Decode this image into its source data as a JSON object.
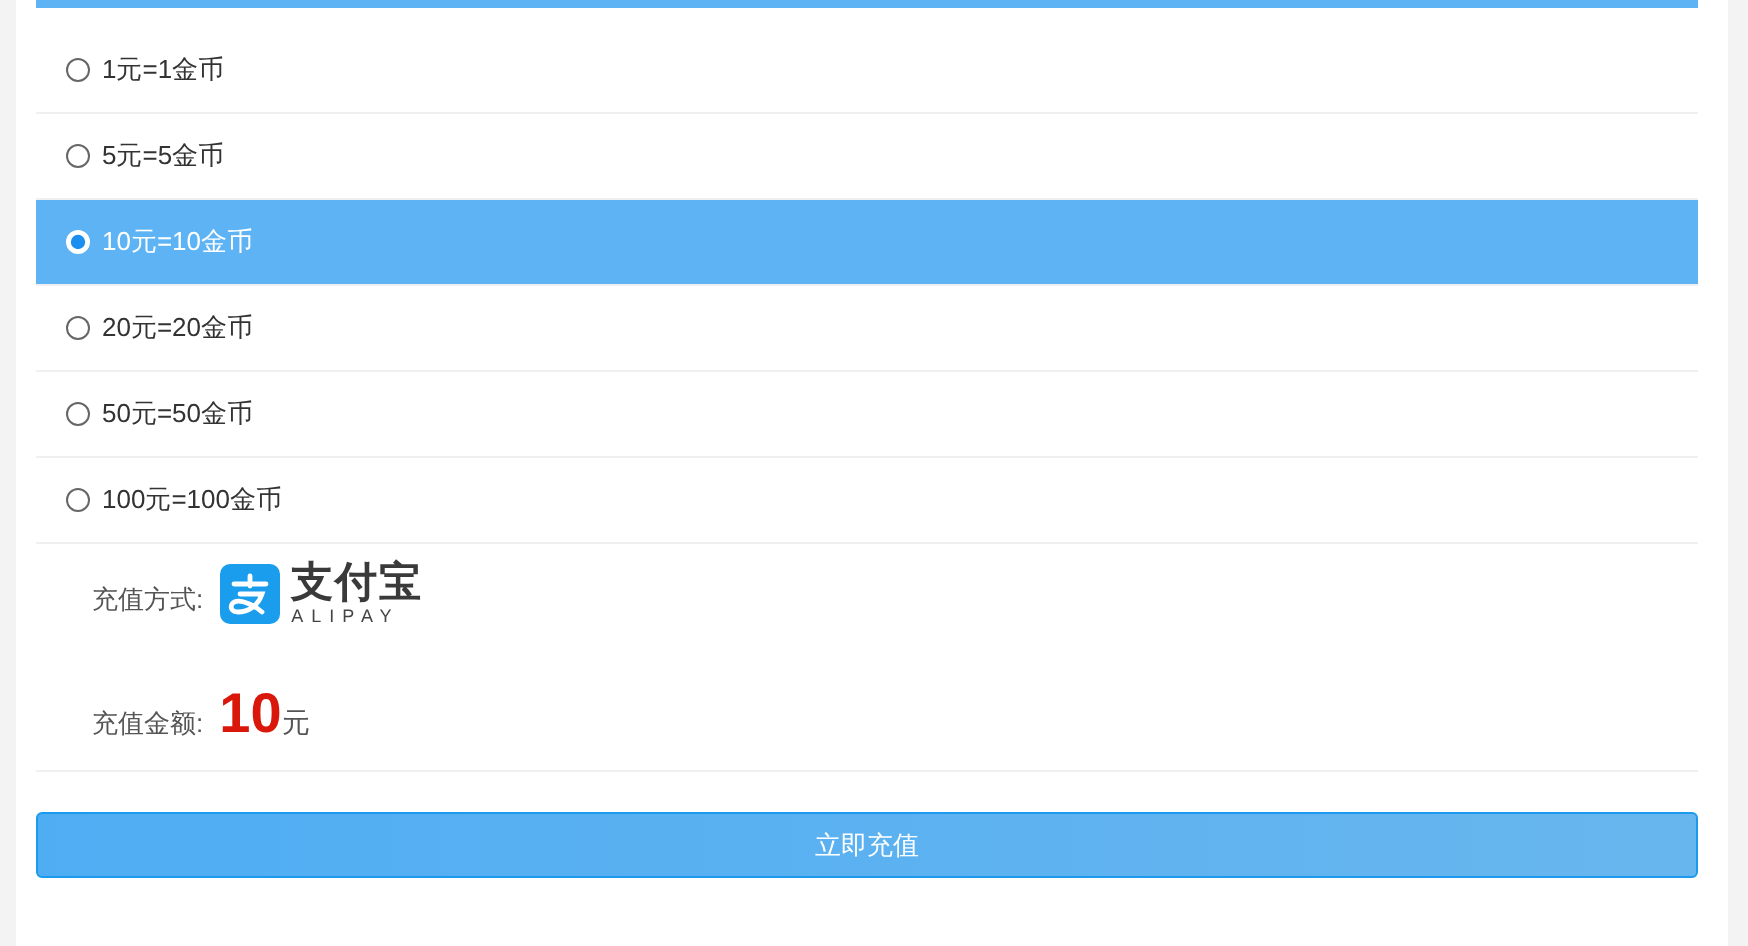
{
  "options": [
    {
      "label": "1元=1金币",
      "selected": false
    },
    {
      "label": "5元=5金币",
      "selected": false
    },
    {
      "label": "10元=10金币",
      "selected": true
    },
    {
      "label": "20元=20金币",
      "selected": false
    },
    {
      "label": "50元=50金币",
      "selected": false
    },
    {
      "label": "100元=100金币",
      "selected": false
    }
  ],
  "payment": {
    "label": "充值方式:",
    "logo_name": "支付宝",
    "logo_sub": "ALIPAY"
  },
  "amount": {
    "label": "充值金额:",
    "value": "10",
    "unit": "元"
  },
  "submit_button": "立即充值"
}
